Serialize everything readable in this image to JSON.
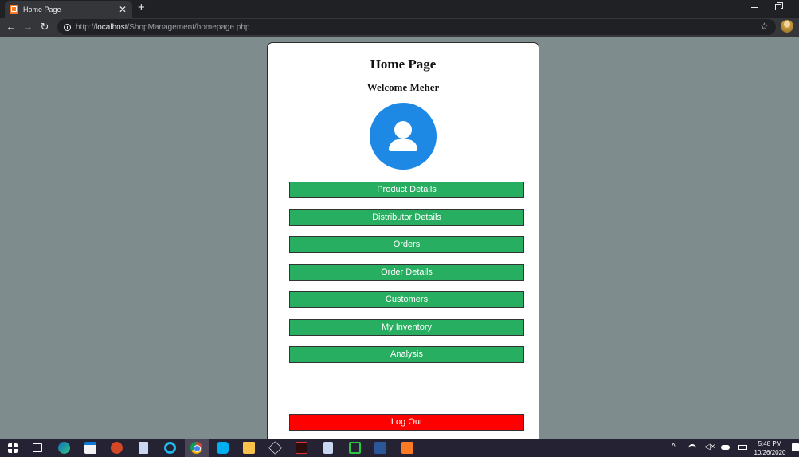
{
  "browser": {
    "tab_title": "Home Page",
    "tab_close": "✕",
    "new_tab": "+",
    "nav_back": "←",
    "nav_forward": "→",
    "nav_reload": "↻",
    "url_scheme": "http://",
    "url_host": "localhost",
    "url_path": "/ShopManagement/homepage.php",
    "star": "☆"
  },
  "page": {
    "title": "Home Page",
    "welcome": "Welcome Meher",
    "menu": [
      {
        "label": "Product Details"
      },
      {
        "label": "Distributor Details"
      },
      {
        "label": "Orders"
      },
      {
        "label": "Order Details"
      },
      {
        "label": "Customers"
      },
      {
        "label": "My Inventory"
      },
      {
        "label": "Analysis"
      }
    ],
    "logout_label": "Log Out",
    "colors": {
      "background": "#7f8c8d",
      "menu_button": "#27ae60",
      "logout_button": "#ff0000",
      "avatar": "#1e88e5"
    }
  },
  "taskbar": {
    "time": "5:48 PM",
    "date": "10/26/2020",
    "tray_chevron": "^",
    "volume_symbol": "◁×",
    "icons": [
      "start-icon",
      "taskview-icon",
      "edge-icon",
      "store-icon",
      "powerpoint-icon",
      "file-icon",
      "internet-explorer-icon",
      "chrome-icon",
      "skype-icon",
      "folder-icon",
      "3d-box-icon",
      "visual-studio-icon",
      "document-icon",
      "green-b-icon",
      "word-icon",
      "xampp-icon"
    ]
  }
}
